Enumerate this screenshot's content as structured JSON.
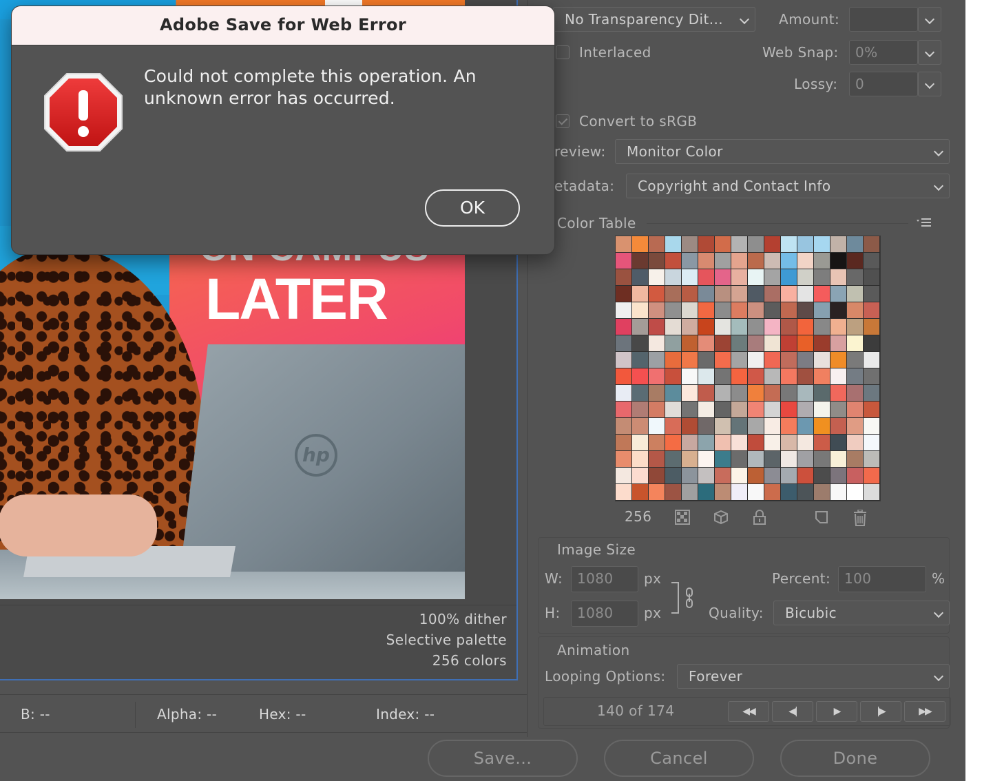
{
  "dialog": {
    "title": "Adobe Save for Web Error",
    "message": "Could not complete this operation. An unknown error has occurred.",
    "ok_label": "OK",
    "icon": "stop-error-icon"
  },
  "artwork": {
    "headline_1": "ON-CAMPUS",
    "headline_2": "LATER",
    "logo": "hp"
  },
  "preview_info": {
    "dither": "100% dither",
    "palette": "Selective palette",
    "colors": "256 colors"
  },
  "status_bar": {
    "b": "B: --",
    "alpha": "Alpha: --",
    "hex": "Hex: --",
    "index": "Index: --"
  },
  "settings": {
    "transparency_dither": "No Transparency Dit...",
    "amount_label": "Amount:",
    "amount_value": "",
    "interlaced_label": "Interlaced",
    "interlaced_checked": false,
    "web_snap_label": "Web Snap:",
    "web_snap_value": "0%",
    "lossy_label": "Lossy:",
    "lossy_value": "0",
    "convert_srgb_label": "Convert to sRGB",
    "convert_srgb_checked": true,
    "preview_label": "review:",
    "preview_value": "Monitor Color",
    "metadata_label": "etadata:",
    "metadata_value": "Copyright and Contact Info"
  },
  "color_table": {
    "title": "Color Table",
    "count": "256",
    "swatches": [
      "#d9926f",
      "#f58a3a",
      "#b86a52",
      "#a9d8ec",
      "#9c8a83",
      "#b04a36",
      "#d26c4a",
      "#b3b3b3",
      "#8e8e8e",
      "#b44030",
      "#bfe3f2",
      "#98c5e0",
      "#a6d7f0",
      "#c1b2a8",
      "#6e8a9c",
      "#8c5a48",
      "#e6557a",
      "#6a3a30",
      "#7a4a3c",
      "#c2503c",
      "#8a98a4",
      "#d88a70",
      "#a0a0a0",
      "#e4a48e",
      "#bb6a4c",
      "#cdbbb3",
      "#74bde8",
      "#f2d4c6",
      "#9a9a94",
      "#161414",
      "#5a2820",
      "#595959",
      "#9a5240",
      "#4f5c68",
      "#f7f1ea",
      "#c9d6de",
      "#dbecf4",
      "#e5555c",
      "#e4648a",
      "#e8b0a0",
      "#e8f4f4",
      "#a4a4a4",
      "#3e9ad4",
      "#d0d0c8",
      "#7d7d7d",
      "#e8c4b4",
      "#686868",
      "#505050",
      "#6e2e22",
      "#f0b8a0",
      "#d25a40",
      "#a86e5a",
      "#b85c44",
      "#7a8a98",
      "#b89080",
      "#d4a492",
      "#505a64",
      "#aa6e64",
      "#f8b0a0",
      "#e4e4e4",
      "#f45c5c",
      "#8aa4b4",
      "#c0c0b0",
      "#5a5a5a",
      "#f0f0f0",
      "#fbe4cc",
      "#d09080",
      "#909090",
      "#dcd8d0",
      "#f26842",
      "#8c8c8c",
      "#dc7c60",
      "#cc9080",
      "#5c5c5c",
      "#c06850",
      "#5e4a48",
      "#86a0b0",
      "#2a2222",
      "#d88868",
      "#c86054",
      "#e04060",
      "#a49c98",
      "#bf4c48",
      "#e4dcd4",
      "#d0aca0",
      "#c8441c",
      "#e4e4e0",
      "#a4bcbc",
      "#909090",
      "#f4b4c4",
      "#b05848",
      "#f2643c",
      "#888888",
      "#f0b090",
      "#bca080",
      "#c87838",
      "#6c747c",
      "#484848",
      "#f4e8e0",
      "#90a0a0",
      "#c06030",
      "#e48c78",
      "#9c4434",
      "#6c7c7c",
      "#a87c7c",
      "#f0e4d4",
      "#c04034",
      "#e86028",
      "#9a3c2c",
      "#d8a0a0",
      "#fbf4d0",
      "#3c3c3c",
      "#d0c4c8",
      "#54646c",
      "#9ca0a4",
      "#e86c3c",
      "#f07848",
      "#6a6a6a",
      "#f46c4c",
      "#a4a4a4",
      "#f0f0f0",
      "#f06854",
      "#c06c5c",
      "#7c7c84",
      "#e8e0dc",
      "#f08c28",
      "#7a7a7a",
      "#eaeaea",
      "#f2583c",
      "#f45050",
      "#f07070",
      "#c8503c",
      "#f8f8f8",
      "#dce8ec",
      "#747474",
      "#f46440",
      "#d05848",
      "#b8b8b8",
      "#f47860",
      "#a05040",
      "#f08060",
      "#f8f0f0",
      "#747c84",
      "#707070",
      "#e8ecf4",
      "#5a6c74",
      "#a87c64",
      "#5c8c9c",
      "#fce8dc",
      "#c05c4c",
      "#b2b2b2",
      "#8c8c8c",
      "#f0803c",
      "#c46c54",
      "#787878",
      "#a8b8bc",
      "#5a6a6c",
      "#f0685c",
      "#a87070",
      "#6c7880",
      "#e8686c",
      "#b07c74",
      "#d47c64",
      "#e0dcd8",
      "#747474",
      "#f4ece4",
      "#646464",
      "#c4a898",
      "#f08474",
      "#d4d4d4",
      "#e84840",
      "#b0acb0",
      "#f4f4ec",
      "#908c88",
      "#e08470",
      "#c8583c",
      "#c48c74",
      "#cc8c74",
      "#f0f8fc",
      "#d86c58",
      "#b04c34",
      "#706868",
      "#d0c0b0",
      "#647478",
      "#a8a8a8",
      "#f8ece4",
      "#f47c5c",
      "#6c98b0",
      "#f09020",
      "#c46050",
      "#e09c84",
      "#f8f8f4",
      "#c07858",
      "#f8ecd8",
      "#cc8060",
      "#f46c44",
      "#c8a8a0",
      "#8ca4ac",
      "#f0c0b0",
      "#f8e0d8",
      "#c04c3c",
      "#f8f0e8",
      "#d8b8a8",
      "#f4e8e0",
      "#cc5c48",
      "#404c54",
      "#f0ccc0",
      "#f4f8fc",
      "#e88c6c",
      "#fcdcc8",
      "#b45848",
      "#5c6c70",
      "#d8b090",
      "#fcf4f0",
      "#3c7c8c",
      "#6c6c6c",
      "#b0b8bc",
      "#5c6468",
      "#f0e8e4",
      "#a0a0a4",
      "#787878",
      "#f8f0d8",
      "#a87c64",
      "#bcbcb8",
      "#f4e8e0",
      "#fcdcd0",
      "#904838",
      "#4c5c64",
      "#8c949c",
      "#c4c0c0",
      "#c86c5c",
      "#fcf4e8",
      "#bc6034",
      "#8c8c94",
      "#a4aab0",
      "#cc503c",
      "#4c4c4c",
      "#7c747c",
      "#c86060",
      "#f26a4c",
      "#fcdccc",
      "#c8542c",
      "#f4845c",
      "#9c5444",
      "#a0a0a0",
      "#2c6c7c",
      "#bc8c74",
      "#f0eef8",
      "#f8f8f8",
      "#cc6c4c",
      "#3c5c6c",
      "#4c5458",
      "#9c7c6c",
      "#f8f8f8",
      "#ffffff",
      "#dcdcdc"
    ]
  },
  "image_size": {
    "title": "Image Size",
    "w_label": "W:",
    "w_value": "1080",
    "h_label": "H:",
    "h_value": "1080",
    "unit": "px",
    "percent_label": "Percent:",
    "percent_value": "100",
    "percent_unit": "%",
    "quality_label": "Quality:",
    "quality_value": "Bicubic"
  },
  "animation": {
    "title": "Animation",
    "looping_label": "Looping Options:",
    "looping_value": "Forever",
    "frame_status": "140 of 174"
  },
  "buttons": {
    "save": "Save...",
    "cancel": "Cancel",
    "done": "Done"
  }
}
